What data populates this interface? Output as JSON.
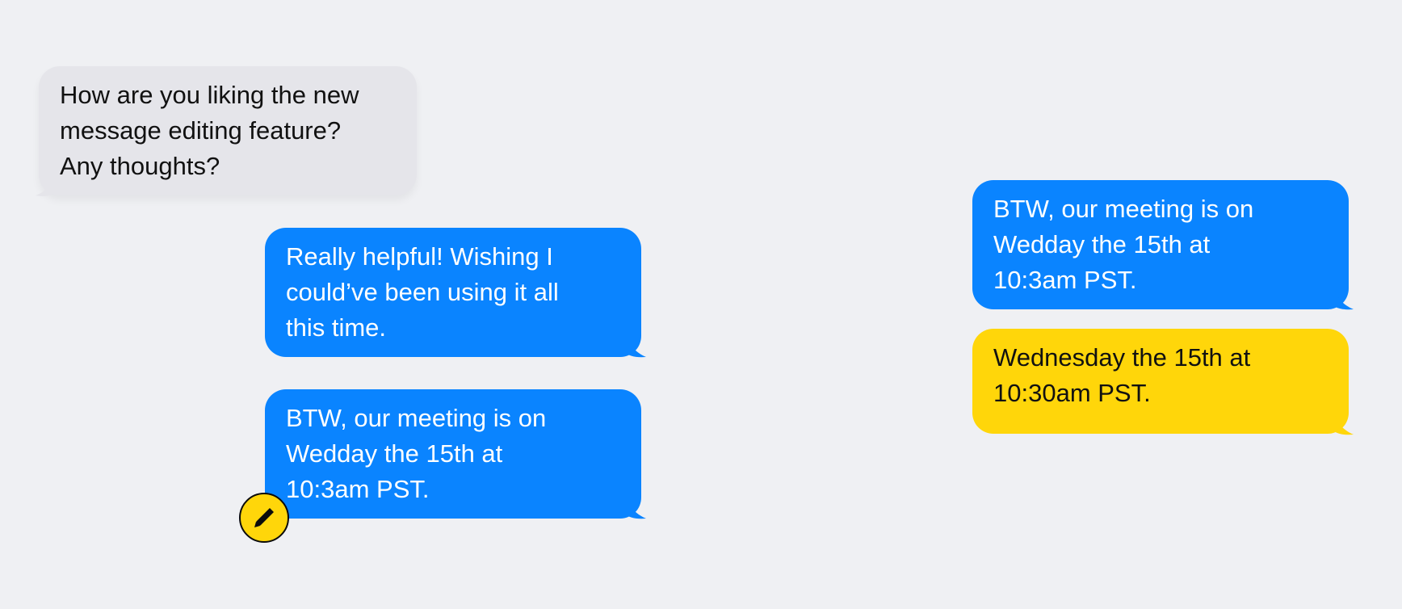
{
  "conversation": {
    "messages": [
      {
        "text": "How are you liking the new\nmessage editing feature?\nAny thoughts?",
        "type": "received"
      },
      {
        "text": "Really helpful! Wishing I\ncould’ve been using it all\nthis time.",
        "type": "sent"
      },
      {
        "text": "BTW, our meeting is on\nWedday the 15th at\n10:3am PST.",
        "type": "sent"
      }
    ]
  },
  "edit_preview": {
    "original_text": "BTW, our meeting is on\nWedday the 15th at\n10:3am PST.",
    "edited_text": "Wednesday the 15th at\n10:30am PST."
  },
  "colors": {
    "background": "#eff0f3",
    "received_bubble": "#e5e5ea",
    "sent_bubble": "#0a84ff",
    "edited_bubble": "#ffd60a"
  },
  "icons": {
    "edit_badge": "pencil-icon"
  }
}
